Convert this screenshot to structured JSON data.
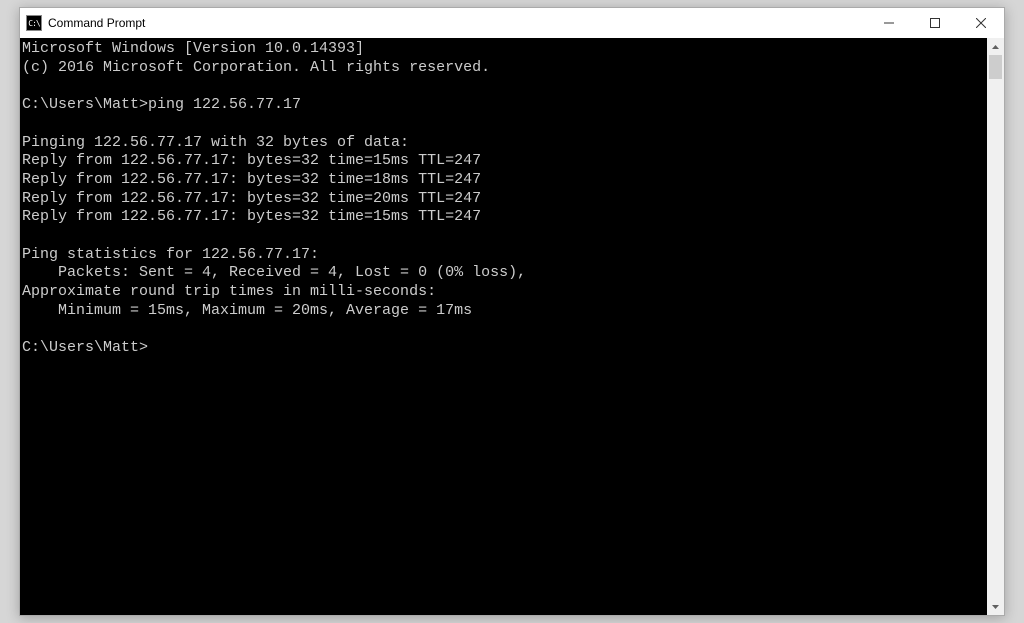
{
  "window": {
    "title": "Command Prompt",
    "icon_label": "C:\\"
  },
  "terminal": {
    "lines": [
      "Microsoft Windows [Version 10.0.14393]",
      "(c) 2016 Microsoft Corporation. All rights reserved.",
      "",
      "C:\\Users\\Matt>ping 122.56.77.17",
      "",
      "Pinging 122.56.77.17 with 32 bytes of data:",
      "Reply from 122.56.77.17: bytes=32 time=15ms TTL=247",
      "Reply from 122.56.77.17: bytes=32 time=18ms TTL=247",
      "Reply from 122.56.77.17: bytes=32 time=20ms TTL=247",
      "Reply from 122.56.77.17: bytes=32 time=15ms TTL=247",
      "",
      "Ping statistics for 122.56.77.17:",
      "    Packets: Sent = 4, Received = 4, Lost = 0 (0% loss),",
      "Approximate round trip times in milli-seconds:",
      "    Minimum = 15ms, Maximum = 20ms, Average = 17ms",
      "",
      "C:\\Users\\Matt>"
    ]
  }
}
